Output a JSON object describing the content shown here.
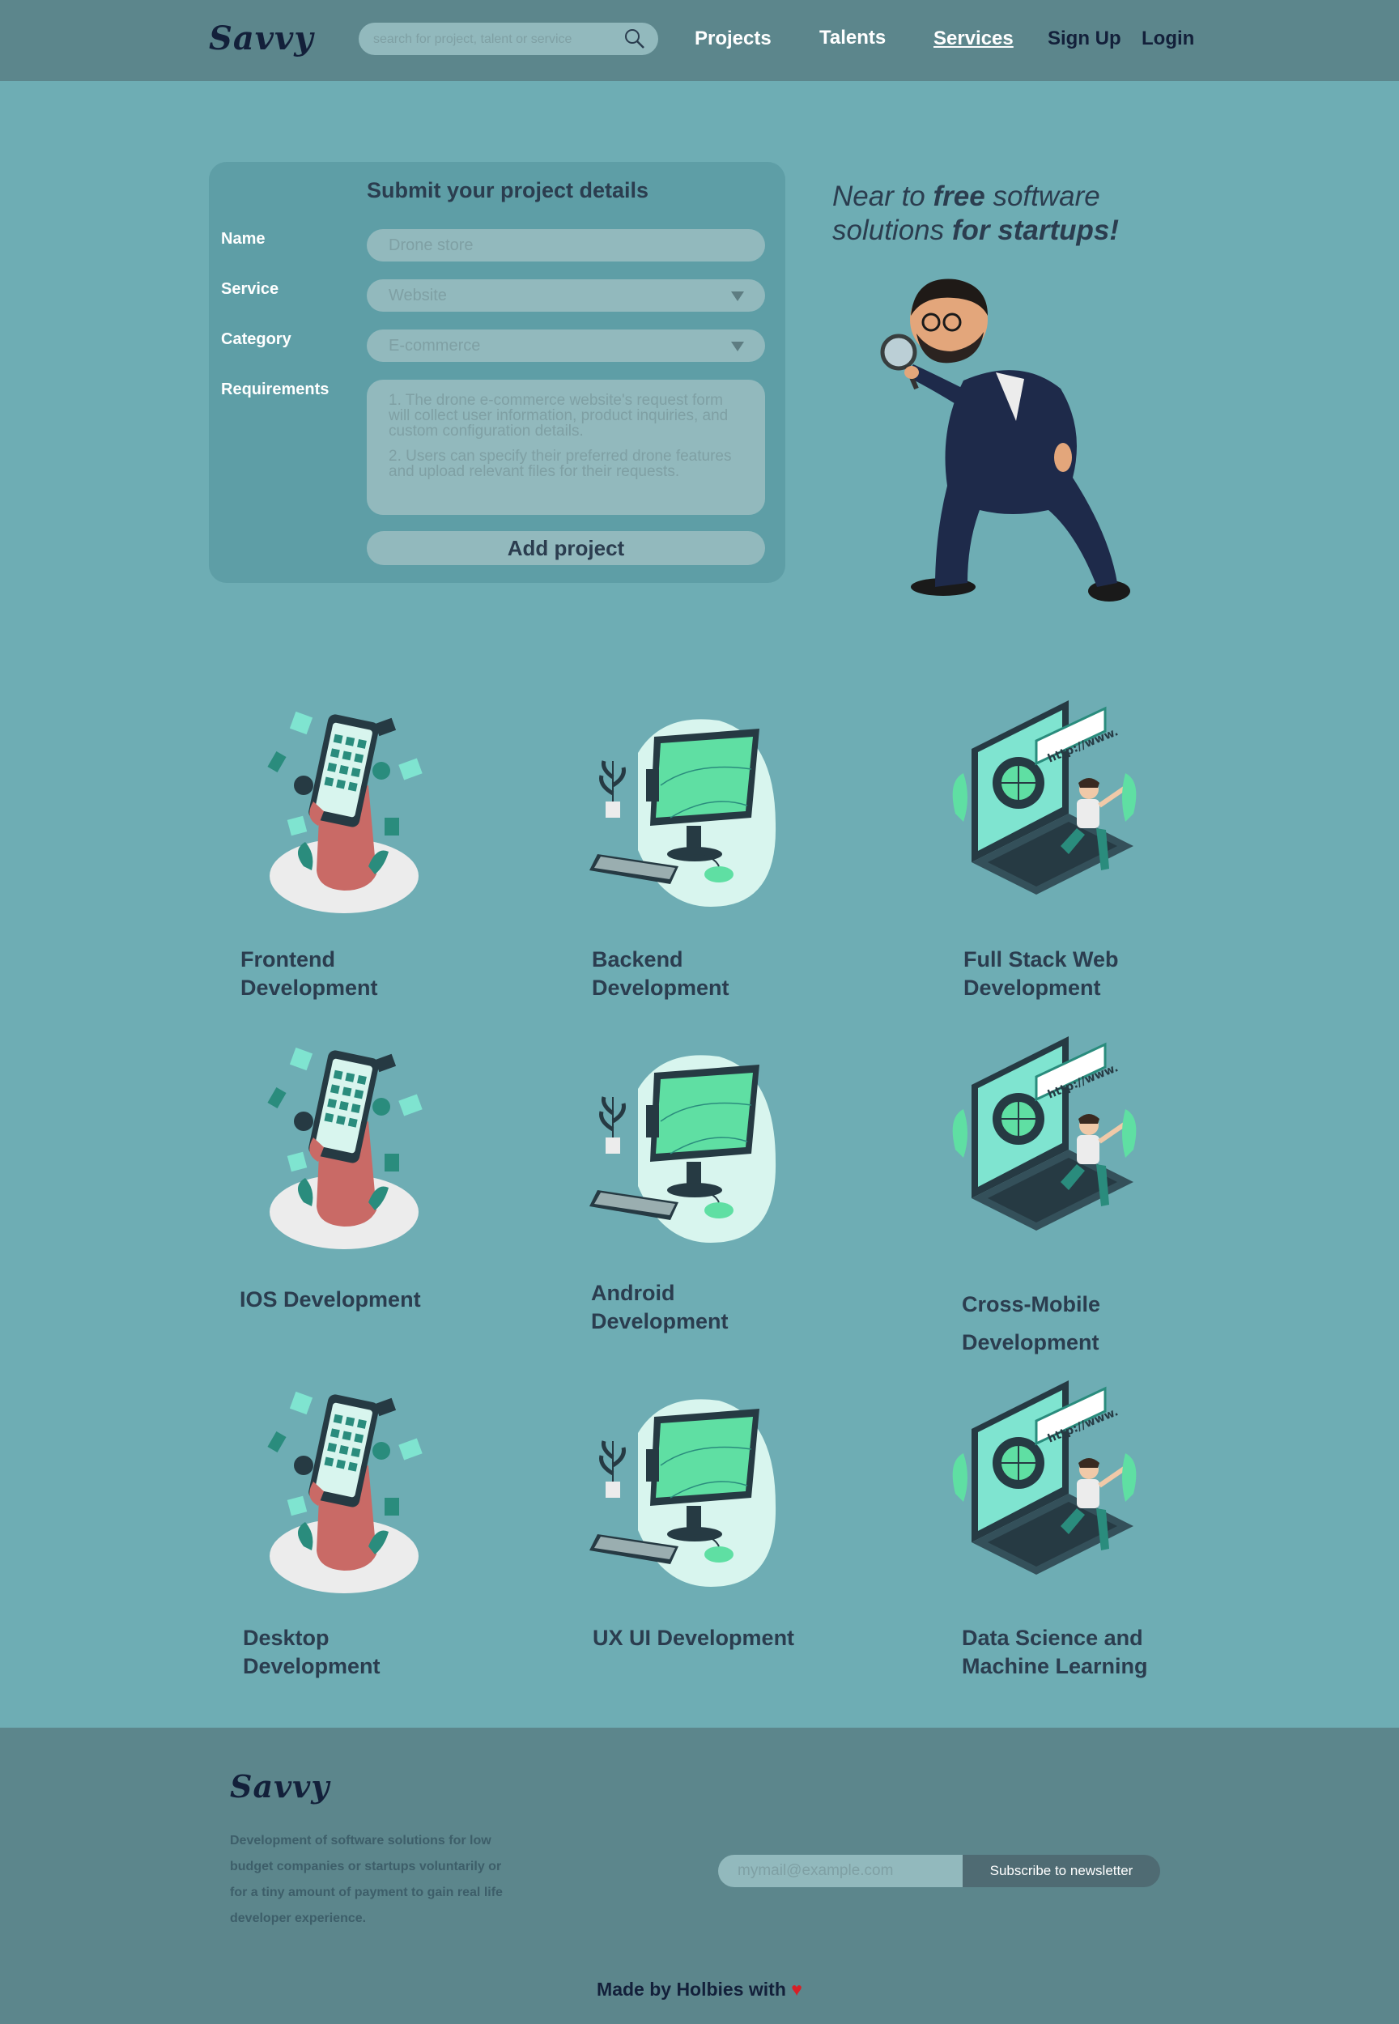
{
  "header": {
    "logo": "Savvy",
    "search_placeholder": "search for project, talent or service",
    "nav": {
      "projects": "Projects",
      "talents": "Talents",
      "services": "Services",
      "signup": "Sign Up",
      "login": "Login"
    }
  },
  "form": {
    "title": "Submit your project details",
    "labels": {
      "name": "Name",
      "service": "Service",
      "category": "Category",
      "requirements": "Requirements"
    },
    "name_value": "Drone store",
    "service_value": "Website",
    "category_value": "E-commerce",
    "requirements": [
      "1. The drone e-commerce website's request form will collect user information, product inquiries, and custom configuration details.",
      "2. Users can specify their preferred drone features and upload relevant files for their requests."
    ],
    "submit": "Add project"
  },
  "hero": {
    "tagline_parts": [
      "Near to ",
      "free",
      " software solutions ",
      "for startups!"
    ]
  },
  "services": [
    "Frontend Development",
    "Backend Development",
    "Full Stack Web Development",
    "IOS Development",
    "Android Development",
    "Cross-Mobile Development",
    "Desktop Development",
    "UX UI Development",
    "Data Science and Machine Learning"
  ],
  "footer": {
    "logo": "Savvy",
    "description": "Development of software solutions for low budget companies or startups voluntarily or for a tiny amount of payment to gain real life developer experience.",
    "email_placeholder": "mymail@example.com",
    "subscribe": "Subscribe to newsletter",
    "made_by": "Made by Holbies with",
    "heart": "♥"
  },
  "colors": {
    "page_bg": "#6eadb4",
    "header_bg": "#5c868c",
    "form_bg": "#5e9ea6",
    "field_bg": "#92b9bd",
    "text_dark": "#2b3d4f",
    "logo": "#13203a",
    "teal_accent": "#5fdfa3"
  },
  "icons": [
    "search-icon",
    "chevron-down-icon",
    "phone-hand-illustration",
    "monitor-illustration",
    "laptop-web-illustration",
    "detective-character-illustration",
    "heart-icon"
  ]
}
